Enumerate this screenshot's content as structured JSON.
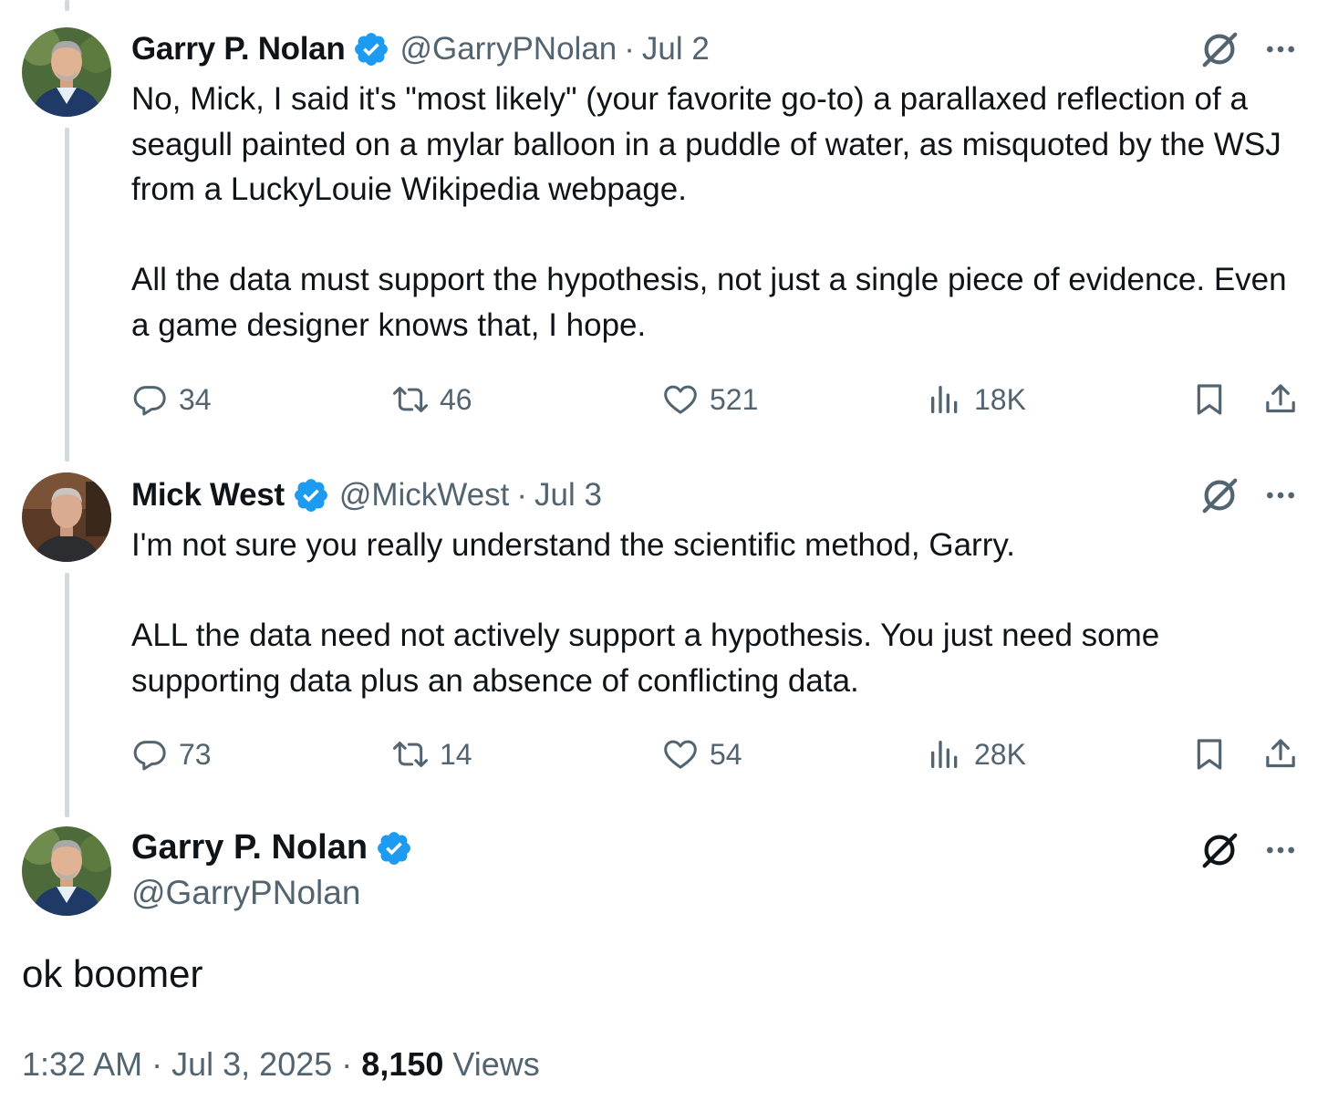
{
  "accent_color": "#1d9bf0",
  "muted_color": "#536471",
  "tweets": [
    {
      "author": "Garry P. Nolan",
      "handle": "@GarryPNolan",
      "separator": "·",
      "date": "Jul 2",
      "verified": true,
      "paragraphs": [
        "No, Mick, I said it's \"most likely\" (your favorite go-to) a parallaxed reflection of a seagull painted on a mylar balloon in a puddle of water, as misquoted by the WSJ from a LuckyLouie Wikipedia webpage.",
        "All the data must support the hypothesis, not just a single piece of evidence. Even a game designer knows that, I hope."
      ],
      "replies": "34",
      "reposts": "46",
      "likes": "521",
      "views": "18K"
    },
    {
      "author": "Mick West",
      "handle": "@MickWest",
      "separator": "·",
      "date": "Jul 3",
      "verified": true,
      "paragraphs": [
        "I'm not sure you really understand the scientific method, Garry.",
        "ALL the data need not actively support a hypothesis. You just need some supporting data plus an absence of conflicting data."
      ],
      "replies": "73",
      "reposts": "14",
      "likes": "54",
      "views": "28K"
    }
  ],
  "main_tweet": {
    "author": "Garry P. Nolan",
    "handle": "@GarryPNolan",
    "verified": true,
    "text": "ok boomer",
    "time": "1:32 AM",
    "separator": "·",
    "date": "Jul 3, 2025",
    "views_count": "8,150",
    "views_label": "Views"
  },
  "icons": {
    "reply": "reply-icon",
    "repost": "repost-icon",
    "like": "like-icon",
    "views": "views-icon",
    "bookmark": "bookmark-icon",
    "share": "share-icon",
    "grok": "grok-icon",
    "more": "more-icon",
    "verified": "verified-badge-icon"
  }
}
